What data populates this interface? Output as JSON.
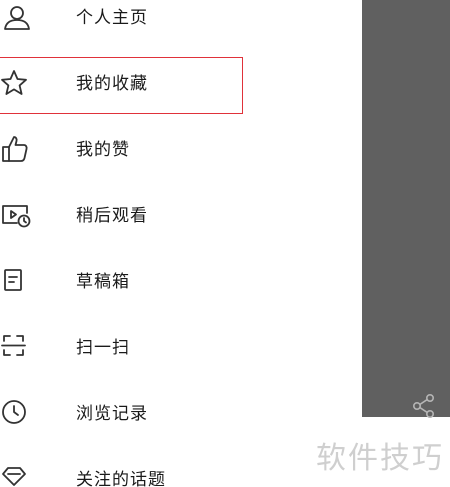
{
  "menu": {
    "items": [
      {
        "label": "个人主页",
        "icon": "person-icon"
      },
      {
        "label": "我的收藏",
        "icon": "star-icon"
      },
      {
        "label": "我的赞",
        "icon": "thumbs-up-icon"
      },
      {
        "label": "稍后观看",
        "icon": "watch-later-icon"
      },
      {
        "label": "草稿箱",
        "icon": "drafts-icon"
      },
      {
        "label": "扫一扫",
        "icon": "scan-icon"
      },
      {
        "label": "浏览记录",
        "icon": "clock-icon"
      },
      {
        "label": "关注的话题",
        "icon": "topic-icon"
      }
    ],
    "highlighted_index": 1
  },
  "overlay": {
    "share_icon": "share-icon"
  },
  "watermark": {
    "text": "软件技巧"
  },
  "colors": {
    "highlight_border": "#e0323a",
    "overlay": "#606060",
    "watermark": "#cfcfcf",
    "icon_stroke": "#333333"
  }
}
